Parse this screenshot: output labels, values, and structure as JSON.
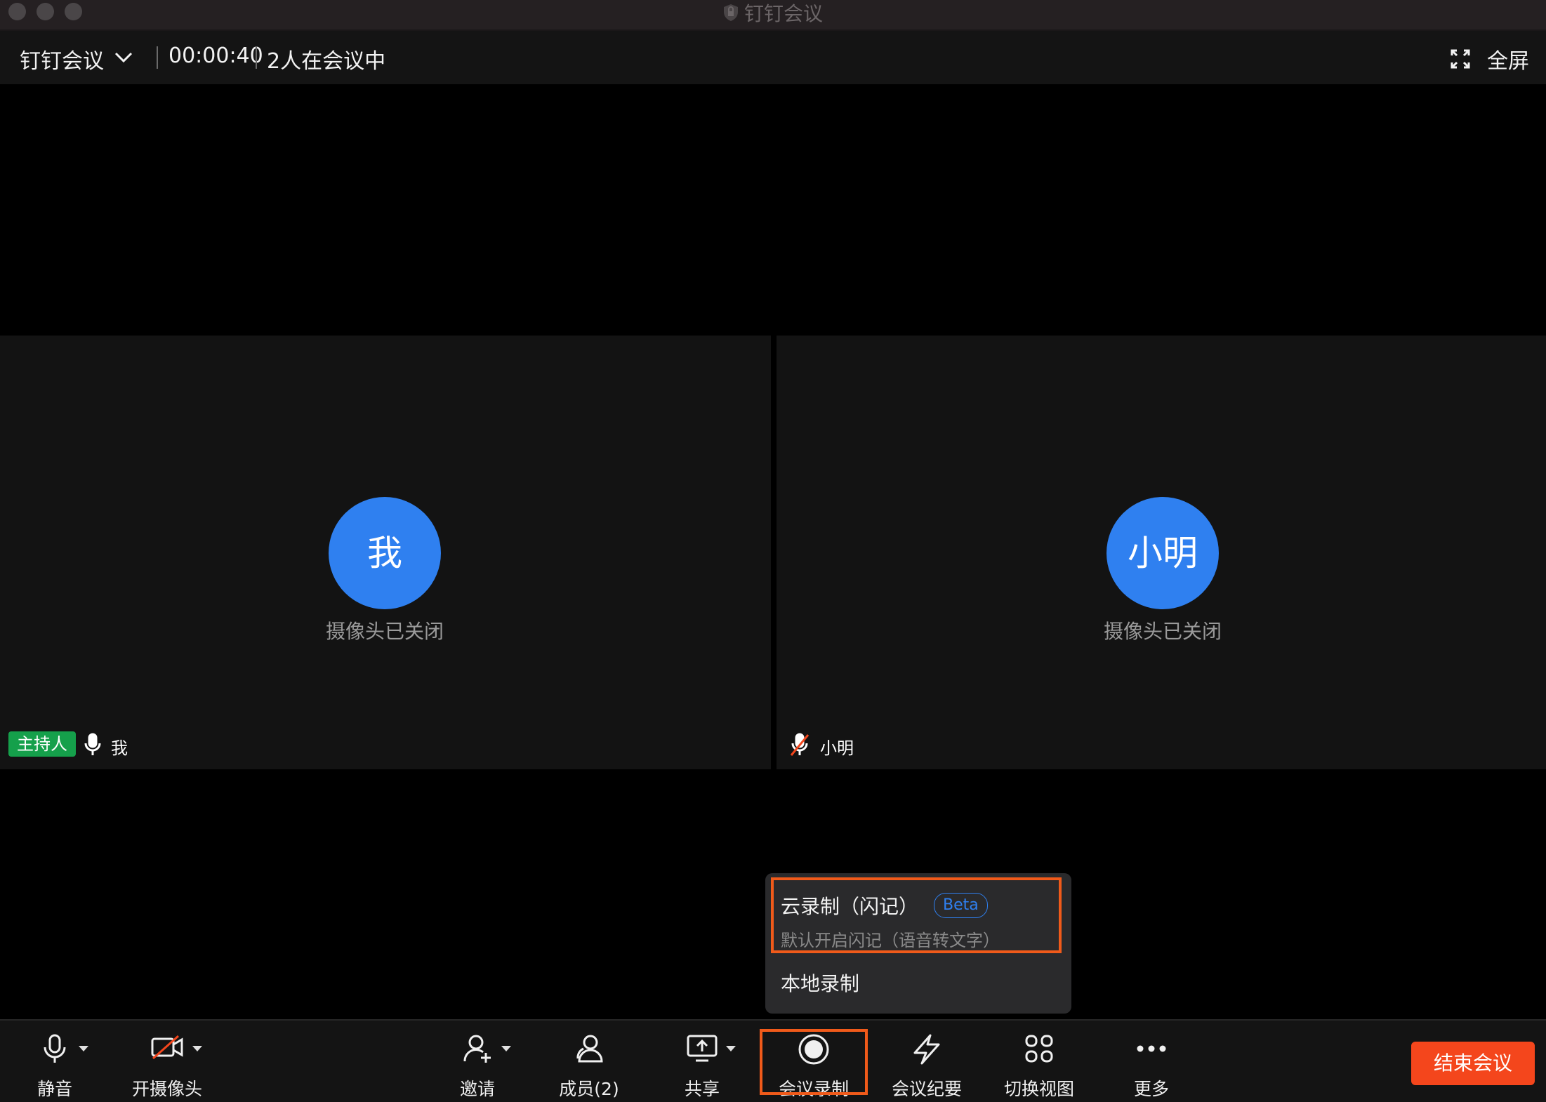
{
  "window": {
    "title": "钉钉会议"
  },
  "topbar": {
    "app_name": "钉钉会议",
    "timer": "00:00:40",
    "people": "2人在会议中",
    "fullscreen_label": "全屏"
  },
  "tiles": [
    {
      "avatar_text": "我",
      "status": "摄像头已关闭",
      "badge": "主持人",
      "name": "我",
      "mic": "on"
    },
    {
      "avatar_text": "小明",
      "status": "摄像头已关闭",
      "name": "小明",
      "mic": "muted"
    }
  ],
  "record_menu": {
    "cloud_label": "云录制（闪记）",
    "cloud_badge": "Beta",
    "cloud_sub": "默认开启闪记（语音转文字）",
    "local_label": "本地录制"
  },
  "toolbar": {
    "mute": "静音",
    "camera": "开摄像头",
    "invite": "邀请",
    "members": "成员(2)",
    "share": "共享",
    "record": "会议录制",
    "minutes": "会议纪要",
    "switch_view": "切换视图",
    "more": "更多",
    "end": "结束会议"
  },
  "colors": {
    "accent_blue": "#2f80f0",
    "end_red": "#f4461c",
    "highlight_orange": "#f05a1a",
    "host_green": "#15a04b"
  }
}
